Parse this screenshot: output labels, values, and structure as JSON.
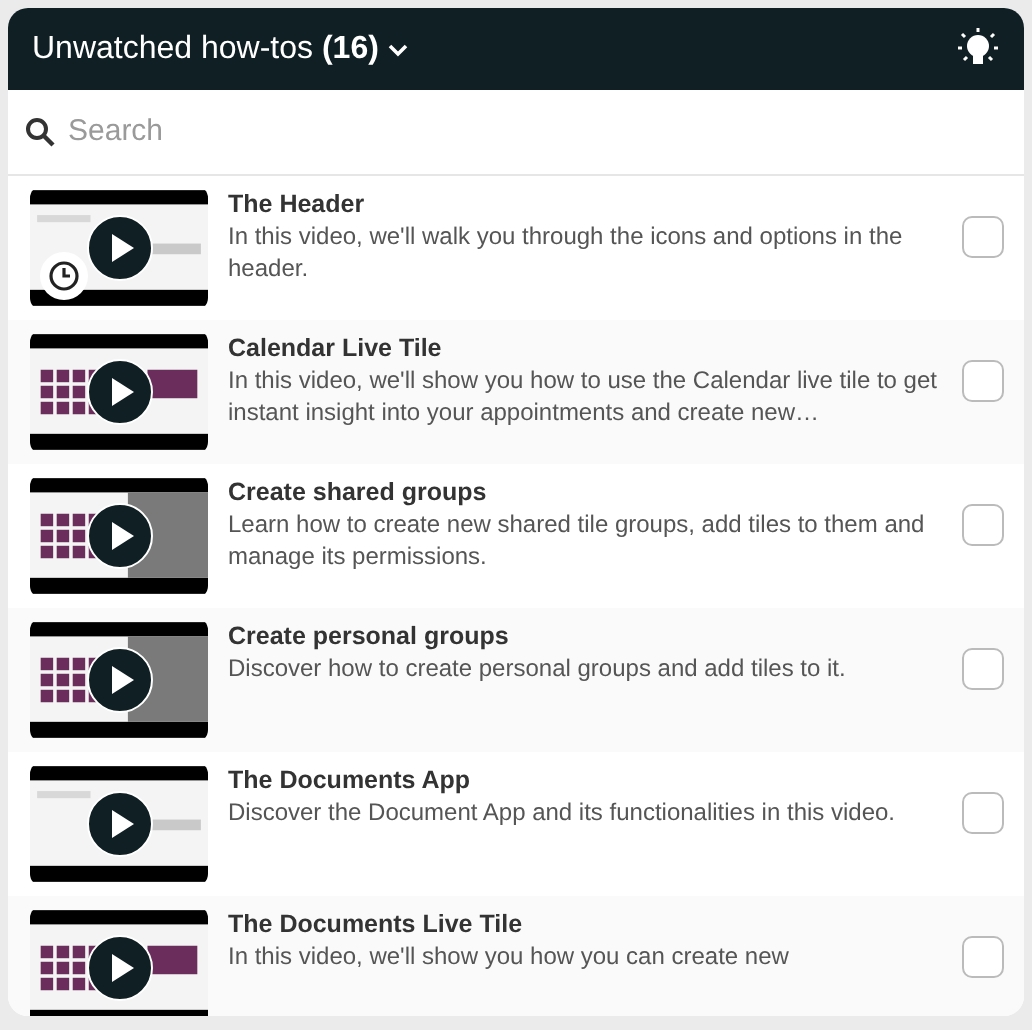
{
  "header": {
    "title": "Unwatched how-tos",
    "count": "(16)"
  },
  "search": {
    "placeholder": "Search"
  },
  "videos": [
    {
      "title": "The Header",
      "description": "In this video, we'll walk you through the icons and options in the header.",
      "in_progress": true,
      "checked": false
    },
    {
      "title": "Calendar Live Tile",
      "description": "In this video, we'll show you how to use the Calendar live tile to get instant insight into your appointments and create new…",
      "in_progress": false,
      "checked": false
    },
    {
      "title": "Create shared groups",
      "description": "Learn how to create new shared tile groups, add tiles to them and manage its permissions.",
      "in_progress": false,
      "checked": false
    },
    {
      "title": "Create personal groups",
      "description": "Discover how to create personal groups and add tiles to it.",
      "in_progress": false,
      "checked": false
    },
    {
      "title": "The Documents App",
      "description": "Discover the Document App and its functionalities in this video.",
      "in_progress": false,
      "checked": false
    },
    {
      "title": "The Documents Live Tile",
      "description": "In this video, we'll show you how you can create new",
      "in_progress": false,
      "checked": false
    }
  ]
}
